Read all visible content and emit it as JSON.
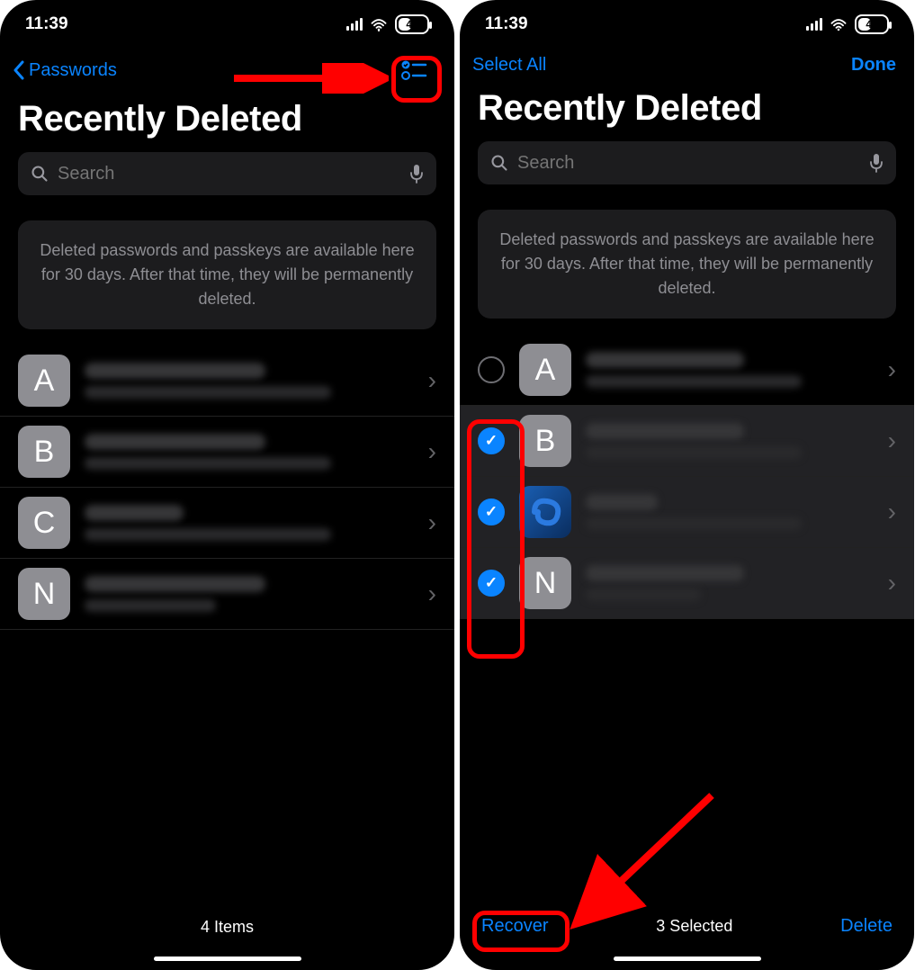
{
  "status": {
    "time": "11:39",
    "battery": "43"
  },
  "left": {
    "back_label": "Passwords",
    "title": "Recently Deleted",
    "search_placeholder": "Search",
    "notice": "Deleted passwords and passkeys are available here for 30 days. After that time, they will be permanently deleted.",
    "rows": [
      {
        "letter": "A"
      },
      {
        "letter": "B"
      },
      {
        "letter": "C"
      },
      {
        "letter": "N"
      }
    ],
    "footer": "4 Items"
  },
  "right": {
    "select_all": "Select All",
    "done": "Done",
    "title": "Recently Deleted",
    "search_placeholder": "Search",
    "notice": "Deleted passwords and passkeys are available here for 30 days. After that time, they will be permanently deleted.",
    "rows": [
      {
        "letter": "A",
        "checked": false,
        "selected": false,
        "custom": false
      },
      {
        "letter": "B",
        "checked": true,
        "selected": true,
        "custom": false
      },
      {
        "letter": "",
        "checked": true,
        "selected": true,
        "custom": true
      },
      {
        "letter": "N",
        "checked": true,
        "selected": true,
        "custom": false
      }
    ],
    "recover": "Recover",
    "selected_label": "3 Selected",
    "delete": "Delete"
  }
}
